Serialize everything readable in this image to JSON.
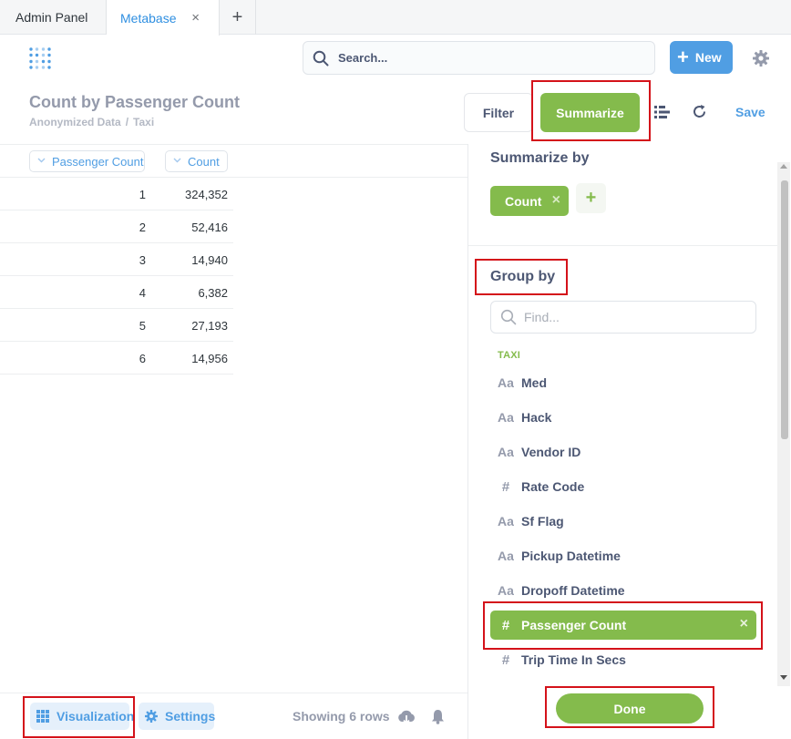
{
  "browser": {
    "tabs": [
      {
        "label": "Admin Panel"
      },
      {
        "label": "Metabase"
      }
    ],
    "close_glyph": "×",
    "new_tab_glyph": "+"
  },
  "nav": {
    "search_placeholder": "Search...",
    "new_label": "New",
    "new_glyph": "+"
  },
  "question": {
    "title": "Count by Passenger Count",
    "breadcrumb": [
      "Anonymized Data",
      "Taxi"
    ],
    "breadcrumb_sep": "/",
    "filter_label": "Filter",
    "summarize_label": "Summarize",
    "save_label": "Save"
  },
  "table": {
    "columns": [
      "Passenger Count",
      "Count"
    ],
    "rows": [
      [
        "1",
        "324,352"
      ],
      [
        "2",
        "52,416"
      ],
      [
        "3",
        "14,940"
      ],
      [
        "4",
        "6,382"
      ],
      [
        "5",
        "27,193"
      ],
      [
        "6",
        "14,956"
      ]
    ]
  },
  "sidebar": {
    "summarize_title": "Summarize by",
    "metric_label": "Count",
    "remove_glyph": "×",
    "add_glyph": "+",
    "groupby_title": "Group by",
    "find_placeholder": "Find...",
    "table_name": "TAXI",
    "fields": [
      {
        "icon": "Aa",
        "label": "Med"
      },
      {
        "icon": "Aa",
        "label": "Hack"
      },
      {
        "icon": "Aa",
        "label": "Vendor ID"
      },
      {
        "icon": "#",
        "label": "Rate Code"
      },
      {
        "icon": "Aa",
        "label": "Sf Flag"
      },
      {
        "icon": "Aa",
        "label": "Pickup Datetime"
      },
      {
        "icon": "Aa",
        "label": "Dropoff Datetime"
      },
      {
        "icon": "#",
        "label": "Passenger Count",
        "selected": true
      },
      {
        "icon": "#",
        "label": "Trip Time In Secs"
      }
    ],
    "done_label": "Done"
  },
  "footer": {
    "visualization_label": "Visualization",
    "settings_label": "Settings",
    "rows_info": "Showing 6 rows"
  },
  "colors": {
    "brand": "#509ee3",
    "summarize_green": "#84bb4c",
    "highlight_red": "#d4121a"
  },
  "icons": [
    "logo-icon",
    "search-icon",
    "gear-icon",
    "list-icon",
    "refresh-icon",
    "chevron-down-icon",
    "download-icon",
    "bell-icon",
    "grid-icon"
  ]
}
